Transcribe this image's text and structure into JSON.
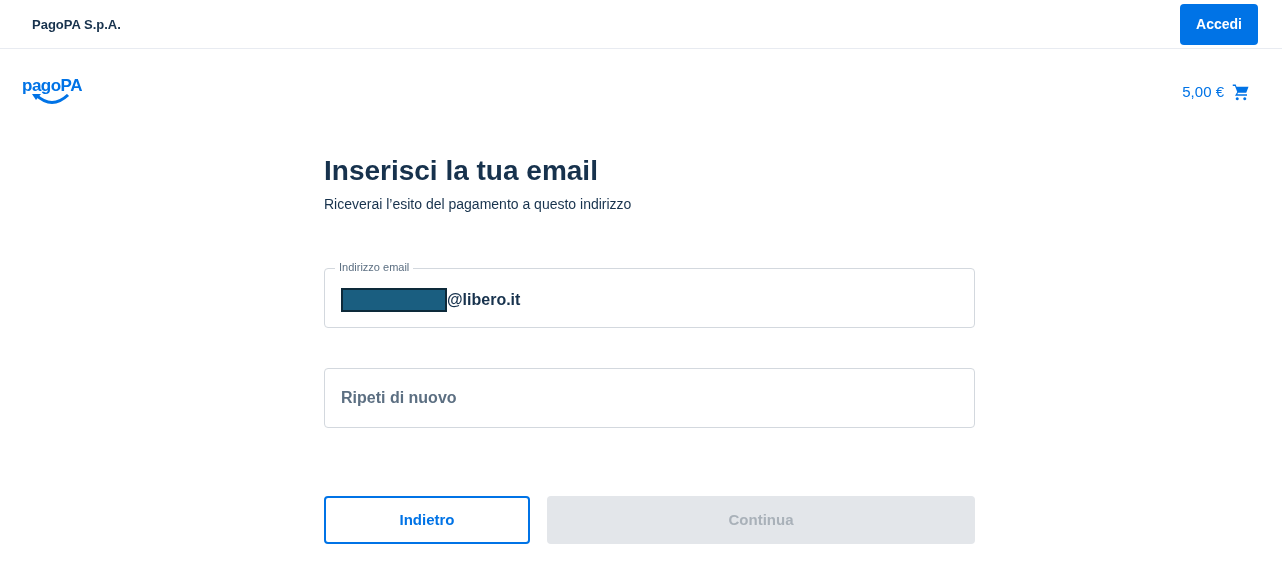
{
  "header": {
    "company": "PagoPA S.p.A.",
    "login_button": "Accedi"
  },
  "brand": {
    "logo": "pagoPA",
    "cart_total": "5,00 €"
  },
  "form": {
    "title": "Inserisci la tua email",
    "subtitle": "Riceverai l’esito del pagamento a questo indirizzo",
    "fields": [
      {
        "label": "Indirizzo email",
        "value": "@libero.it",
        "redacted": true
      },
      {
        "placeholder": "Ripeti di nuovo"
      }
    ],
    "buttons": [
      {
        "label": "Indietro",
        "kind": "outlined",
        "disabled": false
      },
      {
        "label": "Continua",
        "kind": "contained",
        "disabled": true
      }
    ]
  }
}
